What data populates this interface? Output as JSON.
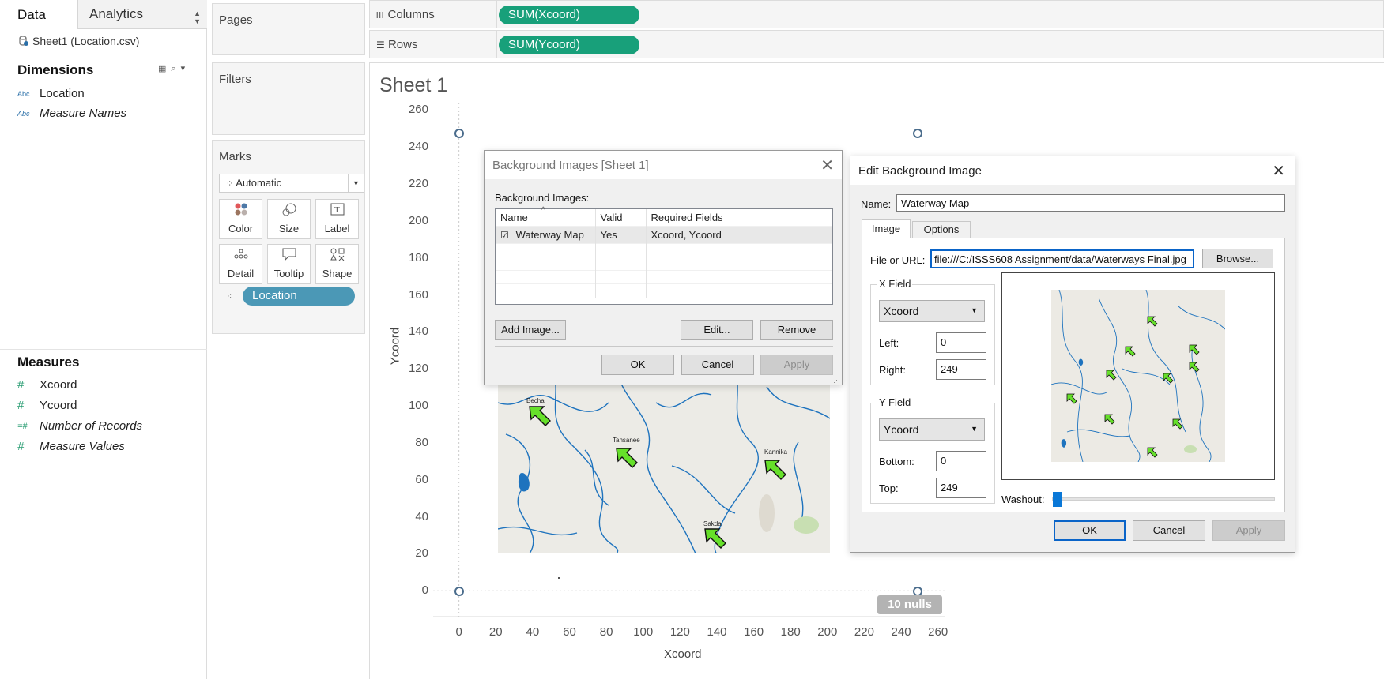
{
  "data_pane": {
    "tab_data": "Data",
    "tab_analytics": "Analytics",
    "datasource": "Sheet1 (Location.csv)",
    "dimensions_title": "Dimensions",
    "dimensions": [
      {
        "type": "Abc",
        "name": "Location"
      },
      {
        "type": "Abc",
        "name": "Measure Names"
      }
    ],
    "measures_title": "Measures",
    "measures": [
      {
        "type": "#",
        "name": "Xcoord"
      },
      {
        "type": "#",
        "name": "Ycoord"
      },
      {
        "type": "=#",
        "name": "Number of Records"
      },
      {
        "type": "#",
        "name": "Measure Values"
      }
    ]
  },
  "cards": {
    "pages": "Pages",
    "filters": "Filters",
    "marks": "Marks",
    "mark_type": "Automatic",
    "marks_buttons": [
      "Color",
      "Size",
      "Label",
      "Detail",
      "Tooltip",
      "Shape"
    ],
    "location_pill": "Location"
  },
  "shelves": {
    "columns_label": "Columns",
    "columns_pill": "SUM(Xcoord)",
    "rows_label": "Rows",
    "rows_pill": "SUM(Ycoord)"
  },
  "view": {
    "sheet_title": "Sheet 1",
    "nulls_badge": "10 nulls",
    "map_labels": [
      "Becha",
      "Tansanee",
      "Kannika",
      "Sakda"
    ]
  },
  "chart_data": {
    "type": "scatter",
    "xlabel": "Xcoord",
    "ylabel": "Ycoord",
    "xlim": [
      -14,
      264
    ],
    "ylim": [
      -14,
      264
    ],
    "x_ticks": [
      0,
      20,
      40,
      60,
      80,
      100,
      120,
      140,
      160,
      180,
      200,
      220,
      240,
      260
    ],
    "y_ticks": [
      0,
      20,
      40,
      60,
      80,
      100,
      120,
      140,
      160,
      180,
      200,
      220,
      240,
      260
    ],
    "background_image": {
      "name": "Waterway Map",
      "x_range": [
        0,
        249
      ],
      "y_range": [
        0,
        249
      ]
    }
  },
  "bg_images_dialog": {
    "title": "Background Images [Sheet 1]",
    "list_label": "Background Images:",
    "columns": [
      "Name",
      "Valid",
      "Required Fields"
    ],
    "rows": [
      {
        "name": "Waterway Map",
        "valid": "Yes",
        "fields": "Xcoord, Ycoord"
      }
    ],
    "add_image": "Add Image...",
    "edit": "Edit...",
    "remove": "Remove",
    "ok": "OK",
    "cancel": "Cancel",
    "apply": "Apply"
  },
  "edit_dialog": {
    "title": "Edit Background Image",
    "name_label": "Name:",
    "name_value": "Waterway Map",
    "tab_image": "Image",
    "tab_options": "Options",
    "file_label": "File or URL:",
    "file_value": "file:///C:/ISSS608 Assignment/data/Waterways Final.jpg",
    "browse": "Browse...",
    "x_field_title": "X Field",
    "x_field_value": "Xcoord",
    "left_label": "Left:",
    "left_value": "0",
    "right_label": "Right:",
    "right_value": "249",
    "y_field_title": "Y Field",
    "y_field_value": "Ycoord",
    "bottom_label": "Bottom:",
    "bottom_value": "0",
    "top_label": "Top:",
    "top_value": "249",
    "washout_label": "Washout:",
    "washout": 0,
    "ok": "OK",
    "cancel": "Cancel",
    "apply": "Apply"
  },
  "colors": {
    "pill_green": "#18a07a",
    "pill_blue": "#4b98b6",
    "river": "#1e73be",
    "arrow": "#66e02a",
    "accent": "#0a64c8"
  }
}
